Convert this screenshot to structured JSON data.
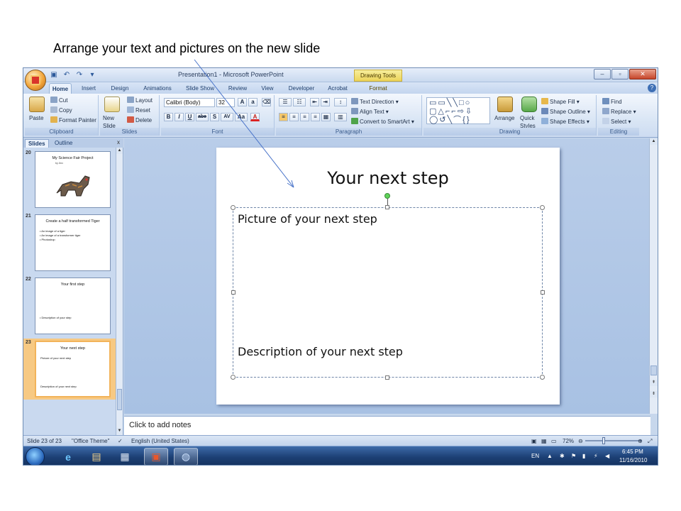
{
  "caption": "Arrange your text and pictures on the new slide",
  "window": {
    "title": "Presentation1 - Microsoft PowerPoint",
    "contextual_tab": "Drawing Tools",
    "min": "–",
    "max": "▫",
    "close": "✕"
  },
  "tabs": [
    "Home",
    "Insert",
    "Design",
    "Animations",
    "Slide Show",
    "Review",
    "View",
    "Developer",
    "Acrobat",
    "Format"
  ],
  "ribbon": {
    "clipboard": {
      "label": "Clipboard",
      "paste": "Paste",
      "cut": "Cut",
      "copy": "Copy",
      "format_painter": "Format Painter"
    },
    "slides": {
      "label": "Slides",
      "new_slide": "New Slide",
      "layout": "Layout",
      "reset": "Reset",
      "delete": "Delete"
    },
    "font": {
      "label": "Font",
      "font_name": "Calibri (Body)",
      "font_size": "32",
      "bold": "B",
      "italic": "I",
      "underline": "U",
      "strike": "abe",
      "shadow": "S",
      "spacing": "AV",
      "case": "Aa",
      "color": "A"
    },
    "paragraph": {
      "label": "Paragraph",
      "text_direction": "Text Direction",
      "align_text": "Align Text",
      "convert_smartart": "Convert to SmartArt"
    },
    "drawing": {
      "label": "Drawing",
      "arrange": "Arrange",
      "quick_styles": "Quick Styles",
      "shape_fill": "Shape Fill",
      "shape_outline": "Shape Outline",
      "shape_effects": "Shape Effects"
    },
    "editing": {
      "label": "Editing",
      "find": "Find",
      "replace": "Replace",
      "select": "Select"
    }
  },
  "pane": {
    "tabs": [
      "Slides",
      "Outline"
    ],
    "close": "x",
    "thumbnails": [
      {
        "num": "20",
        "title": "My Science Fair Project",
        "sub": "by Jinx",
        "bullets": []
      },
      {
        "num": "21",
        "title": "Create a half transformed Tiger",
        "sub": "",
        "bullets": [
          "• An image of a tiger",
          "• An image of a transformer tiger",
          "• Photoshop"
        ]
      },
      {
        "num": "22",
        "title": "Your first step",
        "sub": "",
        "bullets": [
          "• Description of your step"
        ]
      },
      {
        "num": "23",
        "title": "Your next step",
        "sub": "",
        "bullets": [
          "Picture of your next step",
          "Description of your next step"
        ]
      }
    ]
  },
  "slide": {
    "title": "Your next step",
    "body_top": "Picture of your next step",
    "body_bottom": "Description of your next step"
  },
  "notes": "Click to add notes",
  "status": {
    "slide_pos": "Slide 23 of 23",
    "theme": "\"Office Theme\"",
    "language": "English (United States)",
    "zoom": "72%"
  },
  "taskbar": {
    "lang": "EN",
    "time": "6:45 PM",
    "date": "11/16/2010"
  }
}
